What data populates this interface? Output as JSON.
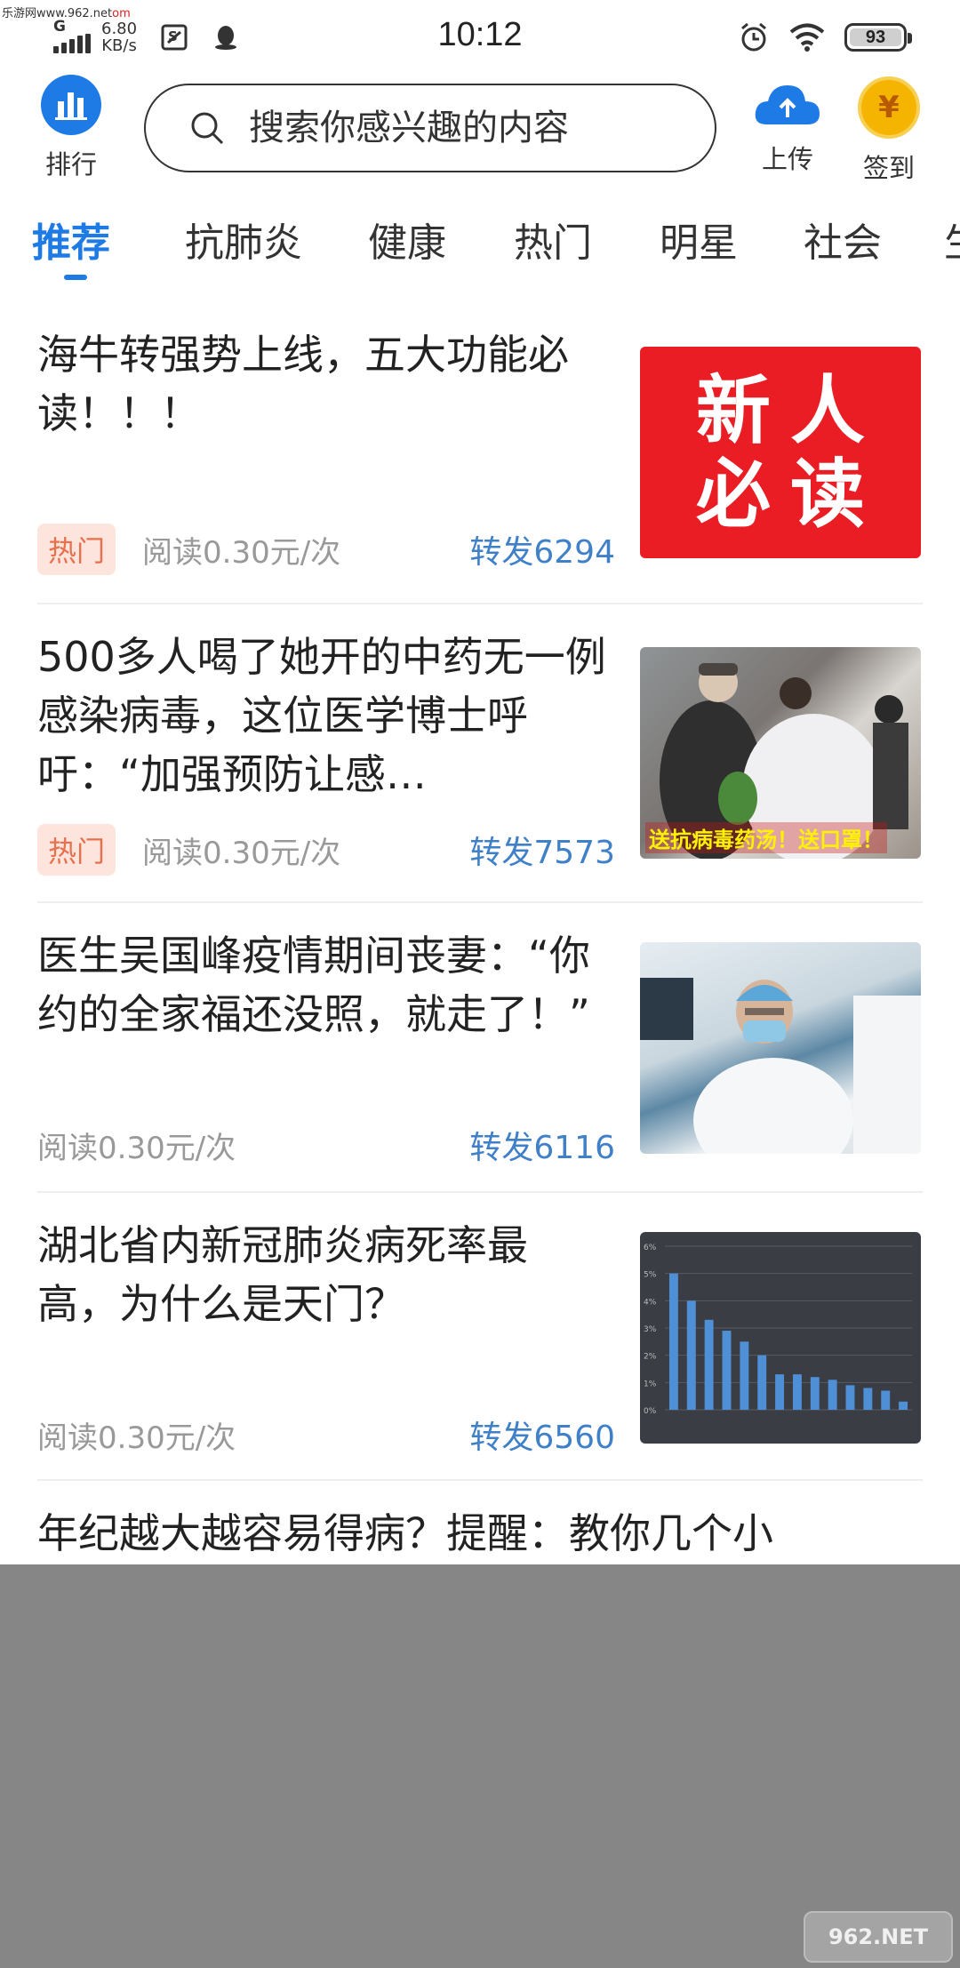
{
  "watermark_top": {
    "site": "乐游网www.962.net",
    "suffix": "om"
  },
  "status": {
    "network": "G",
    "speed_value": "6.80",
    "speed_unit": "KB/s",
    "time": "10:12",
    "battery": "93"
  },
  "header": {
    "rank_label": "排行",
    "search_placeholder": "搜索你感兴趣的内容",
    "upload_label": "上传",
    "signin_label": "签到",
    "coin_symbol": "¥"
  },
  "tabs": [
    {
      "label": "推荐",
      "active": true
    },
    {
      "label": "抗肺炎"
    },
    {
      "label": "健康"
    },
    {
      "label": "热门"
    },
    {
      "label": "明星"
    },
    {
      "label": "社会"
    },
    {
      "label": "生"
    }
  ],
  "articles": [
    {
      "title": "海牛转强势上线，五大功能必读！！！",
      "tag": "热门",
      "reads": "阅读0.30元/次",
      "shares": "转发6294",
      "thumb_text": [
        "新人",
        "必读"
      ]
    },
    {
      "title": "500多人喝了她开的中药无一例感染病毒，这位医学博士呼吁：“加强预防让感…",
      "tag": "热门",
      "reads": "阅读0.30元/次",
      "shares": "转发7573",
      "thumb_caption": "送抗病毒药汤！送口罩！"
    },
    {
      "title": "医生吴国峰疫情期间丧妻：“你约的全家福还没照，就走了！”",
      "reads": "阅读0.30元/次",
      "shares": "转发6116"
    },
    {
      "title": "湖北省内新冠肺炎病死率最高，为什么是天门？",
      "reads": "阅读0.30元/次",
      "shares": "转发6560",
      "thumb_chart": {
        "y_ticks": [
          "6%",
          "5%",
          "4%",
          "3%",
          "2%",
          "1%",
          "0%"
        ],
        "values": [
          5.0,
          4.0,
          3.3,
          2.9,
          2.5,
          2.0,
          1.3,
          1.3,
          1.2,
          1.1,
          0.9,
          0.8,
          0.7,
          0.3
        ]
      }
    },
    {
      "title": "年纪越大越容易得病？提醒：教你几个小"
    }
  ],
  "watermark_bottom": "962.NET"
}
